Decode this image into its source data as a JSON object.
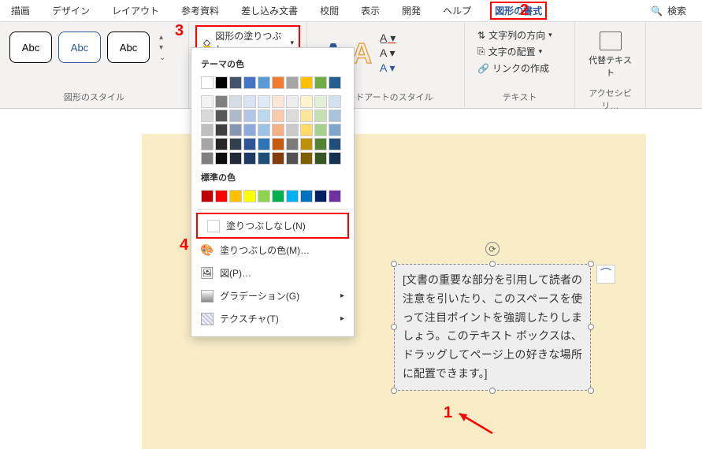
{
  "tabs": [
    "描画",
    "デザイン",
    "レイアウト",
    "参考資料",
    "差し込み文書",
    "校閲",
    "表示",
    "開発",
    "ヘルプ",
    "図形の書式"
  ],
  "search_label": "検索",
  "groups": {
    "shape_styles": "図形のスタイル",
    "wordart": "ワードアートのスタイル",
    "text": "テキスト",
    "access": "アクセシビリ…"
  },
  "shape_sample": "Abc",
  "fill_button": "図形の塗りつぶし",
  "dropdown": {
    "theme": "テーマの色",
    "standard": "標準の色",
    "no_fill": "塗りつぶしなし(N)",
    "more_colors": "塗りつぶしの色(M)…",
    "picture": "図(P)…",
    "gradient": "グラデーション(G)",
    "texture": "テクスチャ(T)"
  },
  "text_group": {
    "direction": "文字列の方向",
    "align": "文字の配置",
    "link": "リンクの作成"
  },
  "alt_text": "代替テキスト",
  "textbox_content": "[文書の重要な部分を引用して読者の注意を引いたり、このスペースを使って注目ポイントを強調したりしましょう。このテキスト ボックスは、ドラッグしてページ上の好きな場所に配置できます。]",
  "annotations": {
    "a1": "1",
    "a2": "2",
    "a3": "3",
    "a4": "4"
  },
  "theme_colors": [
    "#ffffff",
    "#000000",
    "#44546a",
    "#4472c4",
    "#5b9bd5",
    "#ed7d31",
    "#a5a5a5",
    "#ffc000",
    "#70ad47",
    "#255e91"
  ],
  "theme_shades": [
    "#f2f2f2",
    "#7f7f7f",
    "#d6dce4",
    "#d9e2f3",
    "#deebf6",
    "#fbe5d5",
    "#ededed",
    "#fff2cc",
    "#e2efd9",
    "#d4e1ee",
    "#d8d8d8",
    "#595959",
    "#adb9ca",
    "#b4c6e7",
    "#bdd7ee",
    "#f7cbac",
    "#dbdbdb",
    "#fee599",
    "#c5e0b3",
    "#a9c3dd",
    "#bfbfbf",
    "#3f3f3f",
    "#8496b0",
    "#8eaadb",
    "#9cc3e5",
    "#f4b183",
    "#c9c9c9",
    "#ffd965",
    "#a8d08d",
    "#7ea6cc",
    "#a5a5a5",
    "#262626",
    "#323f4f",
    "#2f5496",
    "#2e75b5",
    "#c55a11",
    "#7b7b7b",
    "#bf9000",
    "#538135",
    "#1e4e79",
    "#7f7f7f",
    "#0c0c0c",
    "#222a35",
    "#1f3864",
    "#1f4e79",
    "#833c0b",
    "#525252",
    "#7f6000",
    "#375623",
    "#143350"
  ],
  "standard_colors": [
    "#c00000",
    "#ff0000",
    "#ffc000",
    "#ffff00",
    "#92d050",
    "#00b050",
    "#00b0f0",
    "#0070c0",
    "#002060",
    "#7030a0"
  ]
}
